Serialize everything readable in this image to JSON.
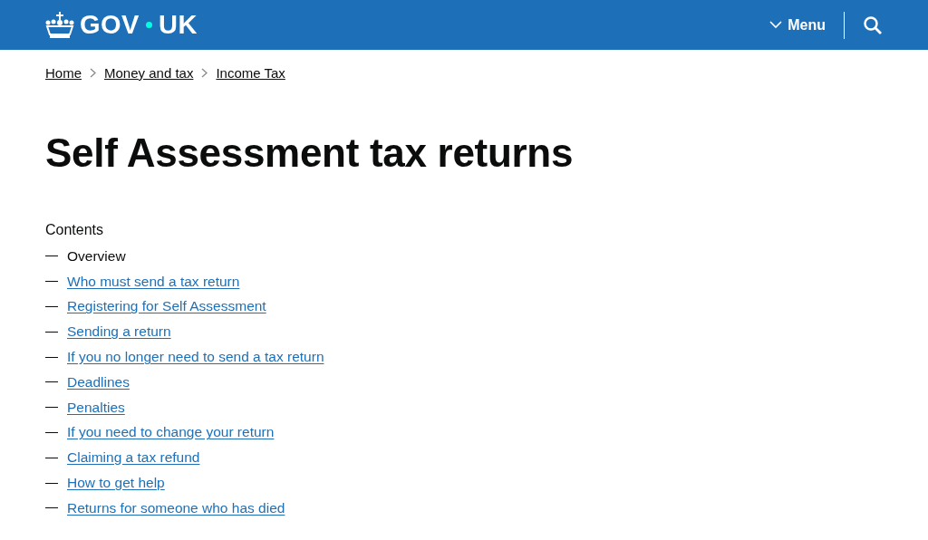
{
  "header": {
    "logo": {
      "left": "GOV",
      "right": "UK"
    },
    "menu_button": "Menu"
  },
  "breadcrumbs": [
    "Home",
    "Money and tax",
    "Income Tax"
  ],
  "title": "Self Assessment tax returns",
  "contents": {
    "heading": "Contents",
    "items": [
      {
        "label": "Overview",
        "selected": true
      },
      {
        "label": "Who must send a tax return",
        "selected": false
      },
      {
        "label": "Registering for Self Assessment",
        "selected": false
      },
      {
        "label": "Sending a return",
        "selected": false
      },
      {
        "label": "If you no longer need to send a tax return",
        "selected": false
      },
      {
        "label": "Deadlines",
        "selected": false
      },
      {
        "label": "Penalties",
        "selected": false
      },
      {
        "label": "If you need to change your return",
        "selected": false
      },
      {
        "label": "Claiming a tax refund",
        "selected": false
      },
      {
        "label": "How to get help",
        "selected": false
      },
      {
        "label": "Returns for someone who has died",
        "selected": false
      }
    ]
  }
}
